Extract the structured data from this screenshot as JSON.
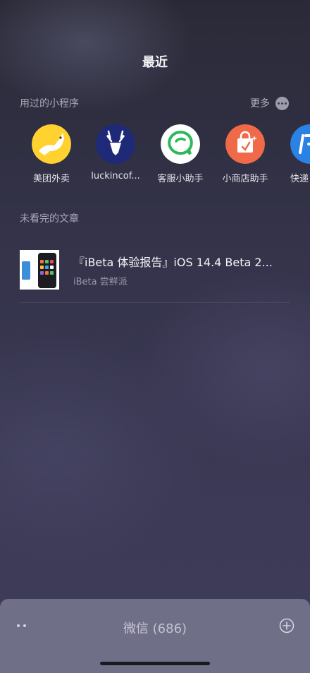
{
  "header": {
    "title": "最近"
  },
  "mini_programs": {
    "section_title": "用过的小程序",
    "more_label": "更多",
    "items": [
      {
        "label": "美团外卖",
        "icon": "meituan-kangaroo-icon",
        "color": "#ffd230"
      },
      {
        "label": "luckincof...",
        "icon": "luckin-deer-icon",
        "color": "#1e2a78"
      },
      {
        "label": "客服小助手",
        "icon": "chat-bubble-icon",
        "color": "#2fb85a"
      },
      {
        "label": "小商店助手",
        "icon": "shopping-bag-icon",
        "color": "#f06a4a"
      },
      {
        "label": "快递",
        "icon": "express-logo-icon",
        "color": "#2a82e4"
      }
    ]
  },
  "articles": {
    "section_title": "未看完的文章",
    "items": [
      {
        "title": "『iBeta 体验报告』iOS 14.4 Beta 2...",
        "source": "iBeta 尝鲜派"
      }
    ]
  },
  "bottom_bar": {
    "title": "微信 (686)"
  }
}
